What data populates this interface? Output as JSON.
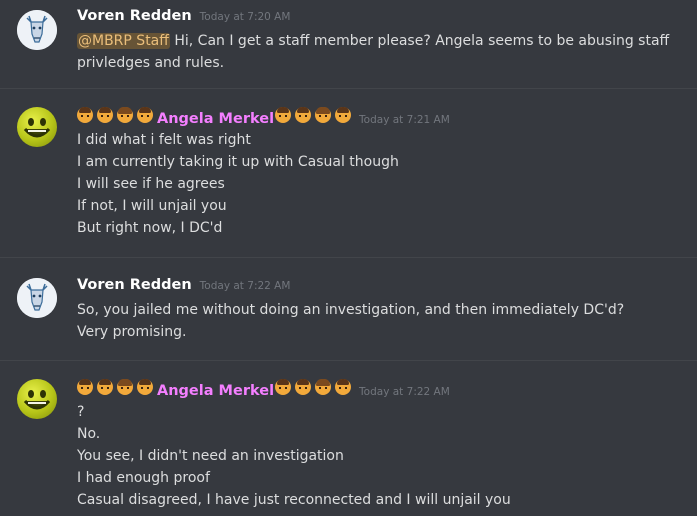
{
  "messages": [
    {
      "author": "Voren Redden",
      "timestamp": "Today at 7:20 AM",
      "mention": "@MBRP Staff",
      "lines": [
        " Hi, Can I get a staff member please? Angela seems to be abusing staff",
        "privledges and rules."
      ]
    },
    {
      "author": "Angela Merkel",
      "timestamp": "Today at 7:21 AM",
      "lines": [
        "I did what i felt was right",
        "I am currently taking it up with Casual though",
        "I will see if he agrees",
        "If not, I will unjail you",
        "But right now, I DC'd"
      ]
    },
    {
      "author": "Voren Redden",
      "timestamp": "Today at 7:22 AM",
      "lines": [
        "So, you jailed me without doing an investigation, and then immediately DC'd?",
        "Very promising."
      ]
    },
    {
      "author": "Angela Merkel",
      "timestamp": "Today at 7:22 AM",
      "lines": [
        "?",
        "No.",
        "You see, I didn't need an investigation",
        "I had enough proof",
        "Casual disagreed, I have just reconnected and I will unjail you"
      ]
    }
  ],
  "colors": {
    "background": "#36393f",
    "username_default": "#ffffff",
    "username_angela": "#f47fff",
    "mention_text": "#eabe7a",
    "timestamp": "#72767d"
  },
  "icons": {
    "voren_avatar": "deer-head-icon",
    "angela_avatar": "smiley-face-icon",
    "name_decoration": "person-emoji-icon"
  }
}
